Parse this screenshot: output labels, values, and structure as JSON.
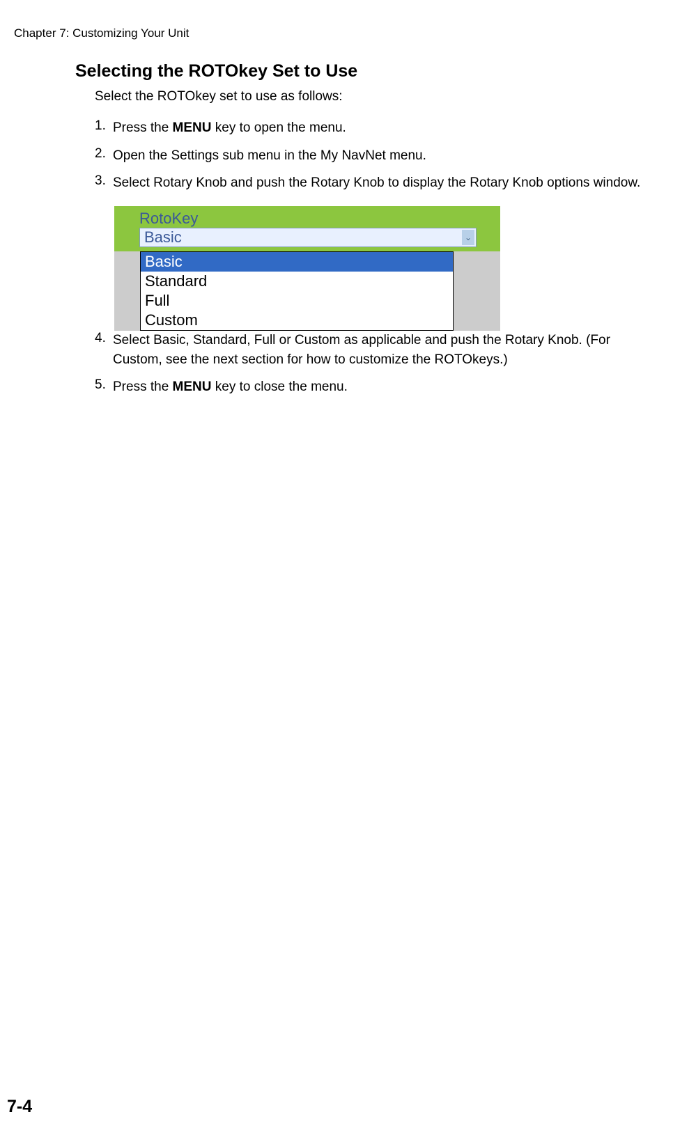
{
  "header": {
    "chapter": "Chapter 7: Customizing Your Unit"
  },
  "section": {
    "title": "Selecting the ROTOkey Set to Use",
    "intro": "Select the ROTOkey set to use as follows:"
  },
  "steps": {
    "s1": {
      "num": "1.",
      "pre": "Press the ",
      "bold": "MENU",
      "post": " key to open the menu."
    },
    "s2": {
      "num": "2.",
      "text": "Open the Settings sub menu in the My NavNet menu."
    },
    "s3": {
      "num": "3.",
      "text": "Select Rotary Knob and push the Rotary Knob to display the Rotary Knob options window."
    },
    "s4": {
      "num": "4.",
      "text": "Select Basic, Standard, Full or Custom as applicable and push the Rotary Knob. (For Custom, see the next section for how to customize the ROTOkeys.)"
    },
    "s5": {
      "num": "5.",
      "pre": "Press the ",
      "bold": "MENU",
      "post": " key to close the menu."
    }
  },
  "figure": {
    "label": "RotoKey",
    "selected": "Basic",
    "options": {
      "o0": "Basic",
      "o1": "Standard",
      "o2": "Full",
      "o3": "Custom"
    }
  },
  "page_number": "7-4"
}
